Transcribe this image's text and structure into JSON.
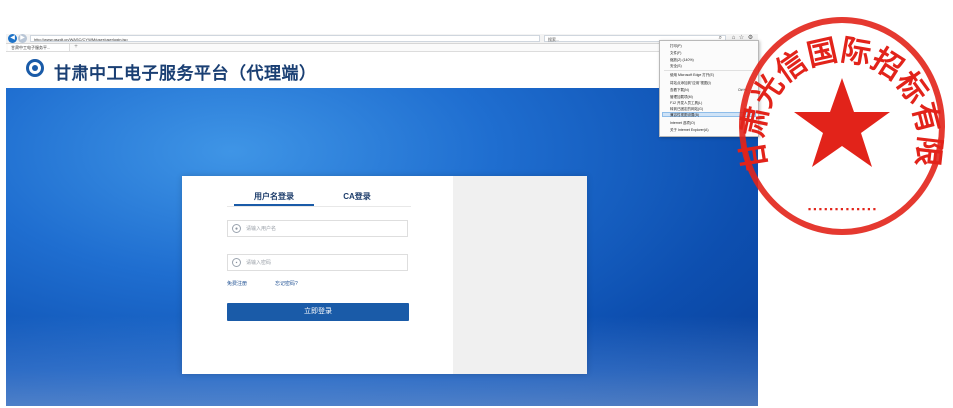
{
  "browser": {
    "url": "http://www.gszdt.cn/WASC/CYWM/user/userlogin.jsp",
    "search_placeholder": "搜索...",
    "tab_title": "甘肃中工电子服务平...",
    "new_tab": "+",
    "icons": {
      "back": "back-arrow-icon",
      "forward": "forward-arrow-icon",
      "search": "search-icon",
      "home": "home-icon",
      "favorites": "star-icon",
      "tools": "gear-icon"
    }
  },
  "header": {
    "title": "甘肃中工电子服务平台（代理端）"
  },
  "login": {
    "tabs": [
      {
        "label": "用户名登录"
      },
      {
        "label": "CA登录"
      }
    ],
    "username_placeholder": "请输入用户名",
    "password_placeholder": "请输入密码",
    "register_link": "免费注册",
    "forgot_link": "忘记密码?",
    "login_button": "立即登录"
  },
  "tools_menu": {
    "items": [
      "打印(P)",
      "文件(F)",
      "缩放(Z) (140%)",
      "安全(S)",
      "使用 Microsoft Edge 打开(E)",
      "将站点添加到\"应用\"视图(I)",
      "查看下载(N)",
      "管理加载项(M)",
      "F12 开发人员工具(L)",
      "转到已固定的网站(G)",
      "兼容性视图设置(B)",
      "Internet 选项(O)",
      "关于 Internet Explorer(A)"
    ],
    "shortcut": "Ctrl+J"
  },
  "stamp": {
    "text": "甘肃光信国际招标有限公司",
    "color": "#e2231a"
  }
}
